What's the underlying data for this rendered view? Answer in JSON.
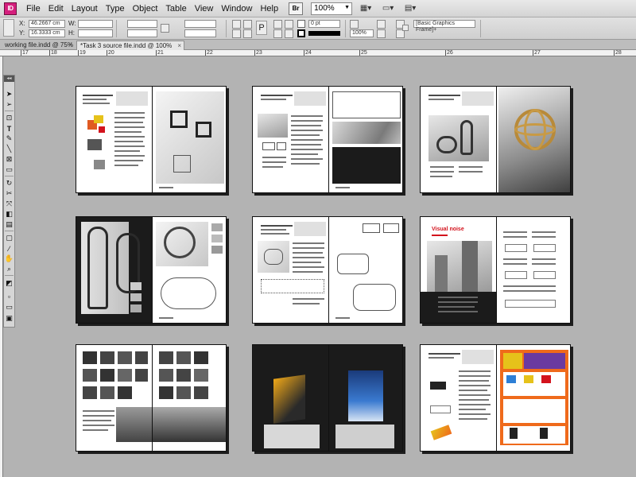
{
  "app": {
    "logo": "ID",
    "menu": [
      "File",
      "Edit",
      "Layout",
      "Type",
      "Object",
      "Table",
      "View",
      "Window",
      "Help"
    ],
    "bridge_label": "Br",
    "zoom": "100%"
  },
  "control_panel": {
    "x_label": "X:",
    "y_label": "Y:",
    "w_label": "W:",
    "h_label": "H:",
    "x_value": "46.2667 cm",
    "y_value": "16.3333 cm",
    "stroke_weight": "0 pt",
    "opacity": "100%",
    "object_style": "[Basic Graphics Frame]+"
  },
  "tabs": [
    {
      "label": "working file.indd @ 75%",
      "active": false
    },
    {
      "label": "*Task 3 source file.indd @ 100%",
      "active": true
    }
  ],
  "ruler": {
    "labels": [
      "17",
      "18",
      "19",
      "20",
      "21",
      "22",
      "23",
      "24",
      "25",
      "26",
      "27",
      "28"
    ]
  },
  "tools": [
    "selection-tool",
    "direct-selection-tool",
    "page-tool",
    "type-tool",
    "pencil-tool",
    "line-tool",
    "rectangle-frame-tool",
    "scissors-tool",
    "free-transform-tool",
    "gradient-tool",
    "note-tool",
    "eyedropper-tool",
    "hand-tool",
    "zoom-tool",
    "fill-stroke",
    "screen-mode"
  ],
  "spread_labels": {
    "visual_noise": "Visual noise"
  },
  "colors": {
    "app_logo": "#d51f7d",
    "pasteboard": "#b3b3b3",
    "accent_red": "#d3131d",
    "accent_orange": "#ef6a1b",
    "accent_yellow": "#e6c21a"
  }
}
